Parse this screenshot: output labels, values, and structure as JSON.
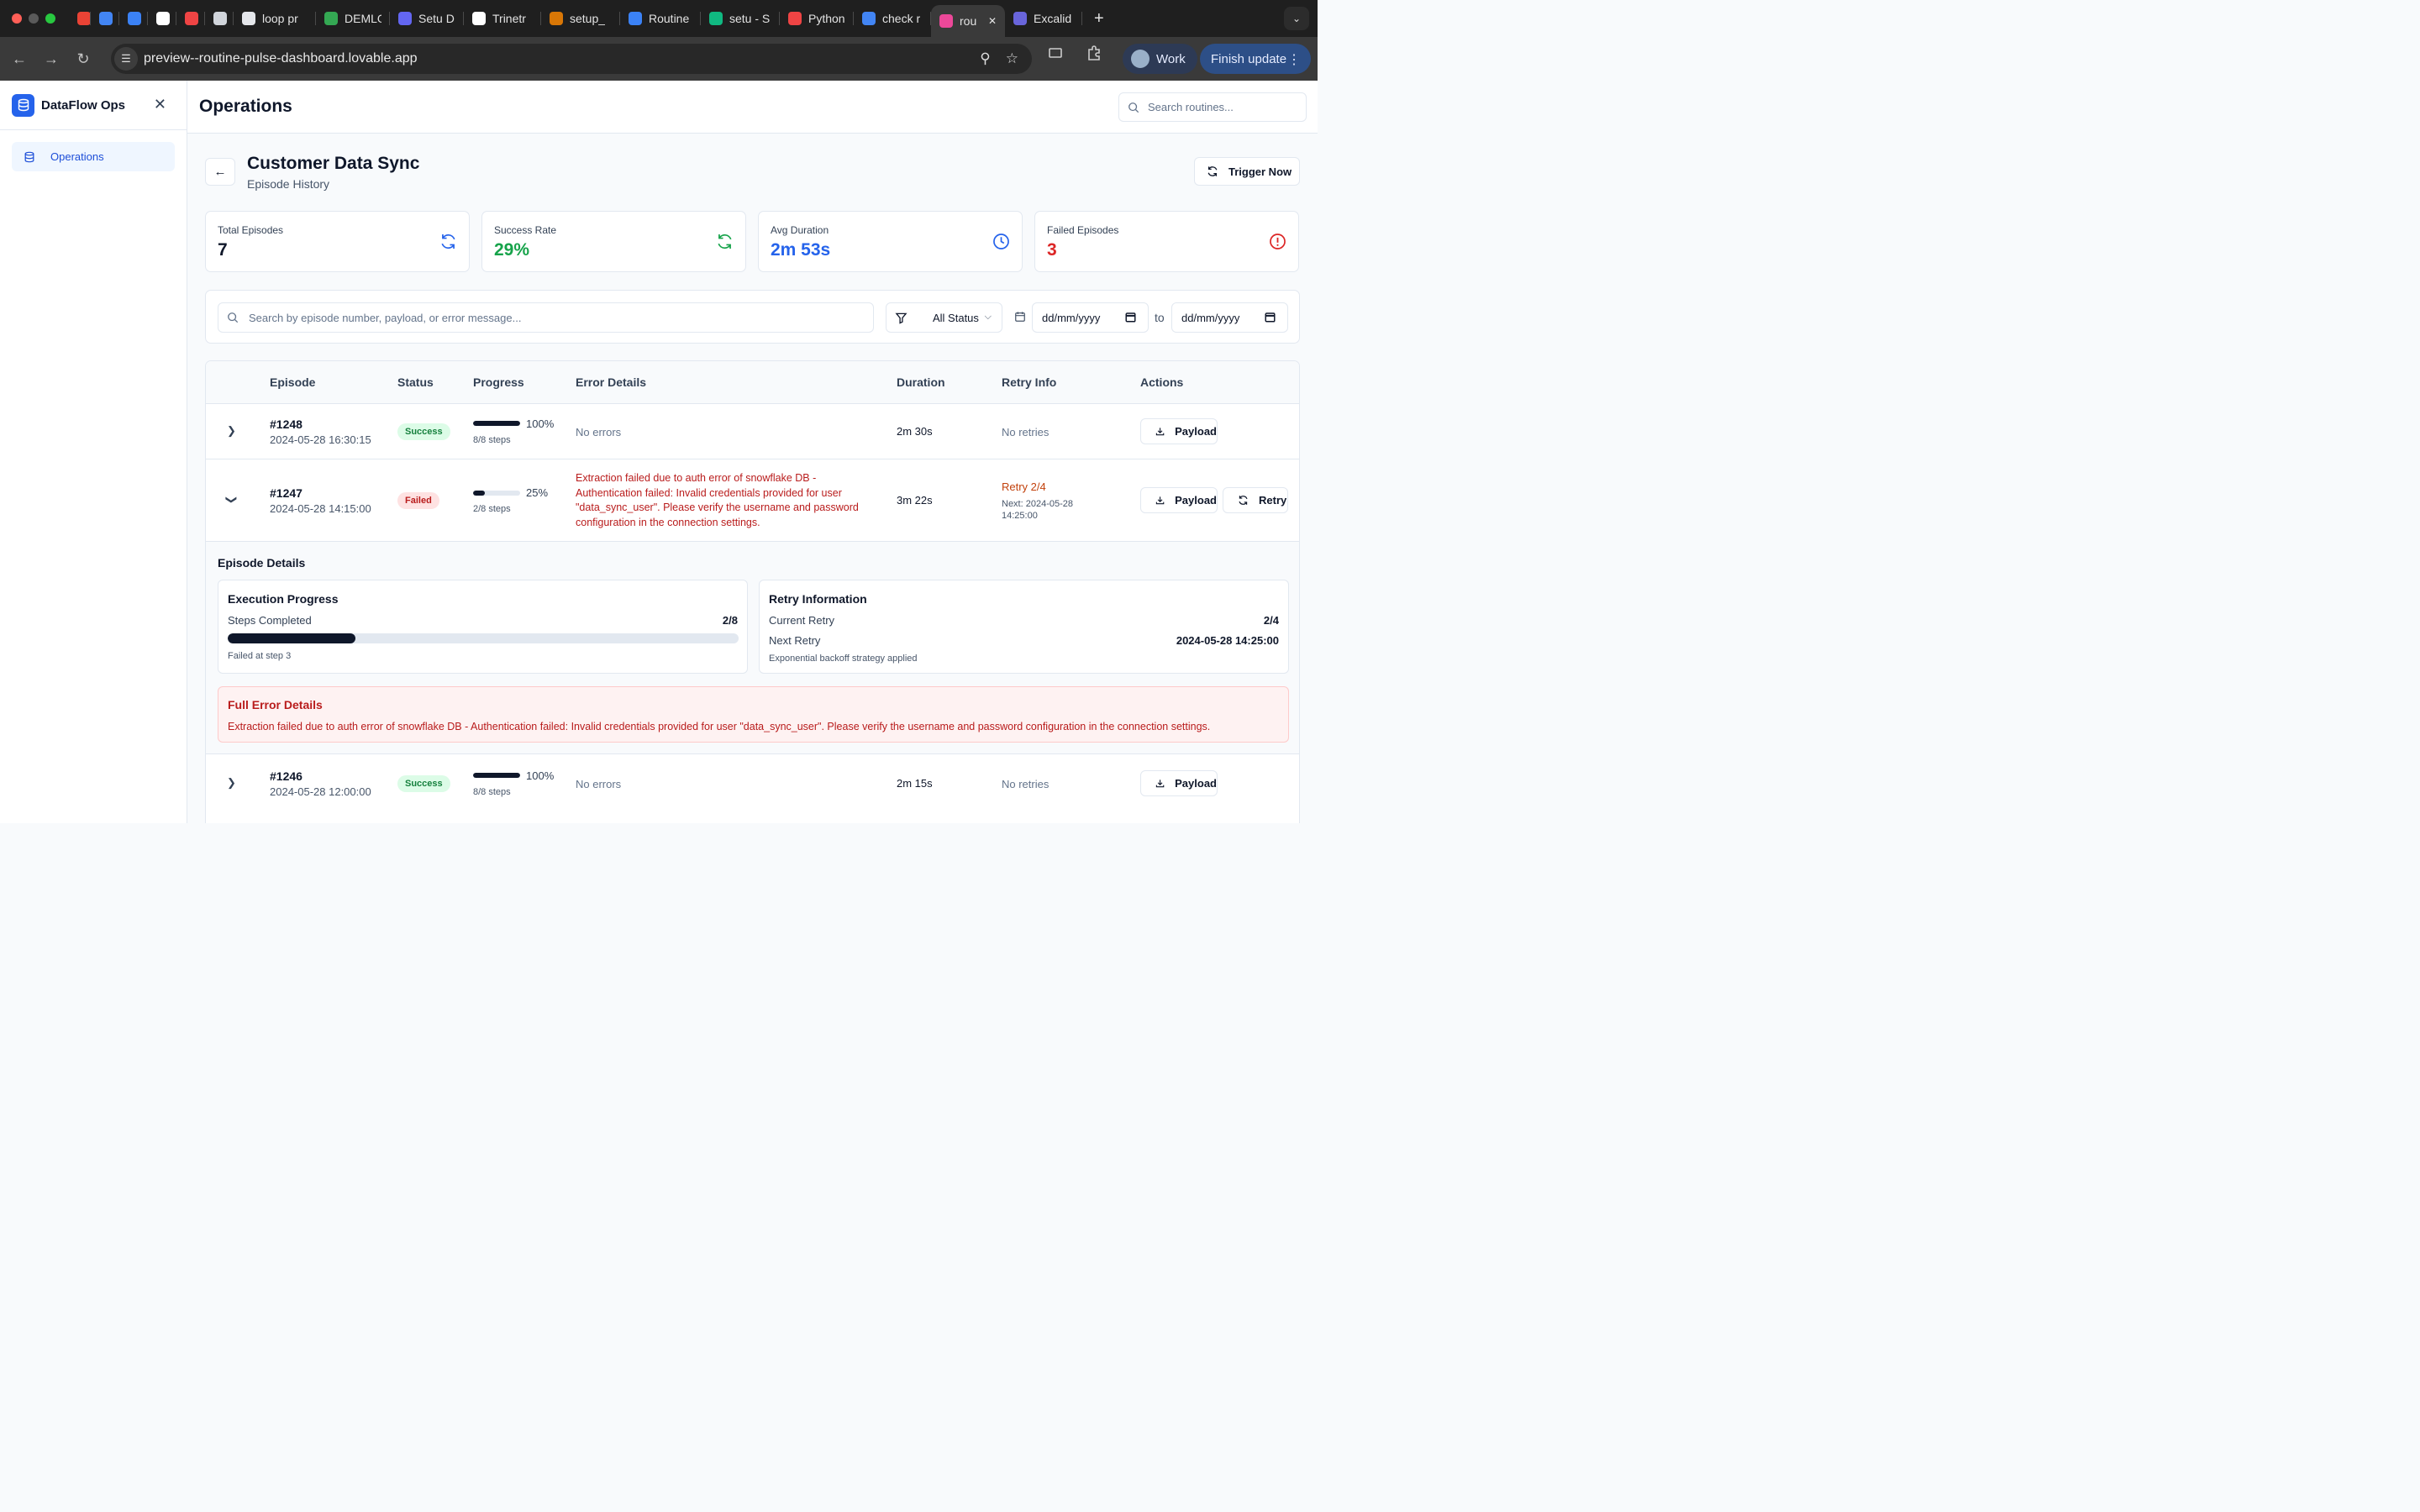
{
  "browser": {
    "tabs": [
      {
        "title": "",
        "icon": "gmail-icon",
        "color": "#ea4335"
      },
      {
        "title": "",
        "icon": "calendar-icon",
        "color": "#4285f4"
      },
      {
        "title": "",
        "icon": "k-icon",
        "color": "#3b82f6"
      },
      {
        "title": "",
        "icon": "github-icon",
        "color": "#ffffff"
      },
      {
        "title": "",
        "icon": "app-icon",
        "color": "#ef4444"
      },
      {
        "title": "",
        "icon": "openai-icon",
        "color": "#d1d5db"
      },
      {
        "title": "loop pr",
        "icon": "loop-icon",
        "color": "#e5e7eb"
      },
      {
        "title": "DEMLO",
        "icon": "drive-icon",
        "color": "#34a853"
      },
      {
        "title": "Setu D",
        "icon": "setu-icon",
        "color": "#6366f1"
      },
      {
        "title": "Trinetr",
        "icon": "trinetra-icon",
        "color": "#ffffff"
      },
      {
        "title": "setup_",
        "icon": "claude-icon",
        "color": "#d97706"
      },
      {
        "title": "Routine",
        "icon": "routine-icon",
        "color": "#3b82f6"
      },
      {
        "title": "setu - S",
        "icon": "setu-s-icon",
        "color": "#10b981"
      },
      {
        "title": "Python",
        "icon": "youtube-icon",
        "color": "#ef4444"
      },
      {
        "title": "check r",
        "icon": "google-icon",
        "color": "#4285f4"
      },
      {
        "title": "rou",
        "icon": "lovable-icon",
        "color": "#ec4899",
        "active": true
      },
      {
        "title": "Excalid",
        "icon": "excalidraw-icon",
        "color": "#6965db"
      }
    ],
    "url": "preview--routine-pulse-dashboard.lovable.app",
    "profile_label": "Work",
    "update_label": "Finish update"
  },
  "sidebar": {
    "brand": "DataFlow Ops",
    "items": [
      {
        "label": "Operations"
      }
    ]
  },
  "header": {
    "title": "Operations",
    "search_placeholder": "Search routines..."
  },
  "page": {
    "title": "Customer Data Sync",
    "subtitle": "Episode History",
    "trigger_label": "Trigger Now"
  },
  "stats": [
    {
      "label": "Total Episodes",
      "value": "7",
      "color": "#0f172a",
      "icon": "refresh-icon",
      "icon_color": "#2563eb"
    },
    {
      "label": "Success Rate",
      "value": "29%",
      "color": "#16a34a",
      "icon": "refresh-icon",
      "icon_color": "#16a34a"
    },
    {
      "label": "Avg Duration",
      "value": "2m 53s",
      "color": "#2563eb",
      "icon": "clock-icon",
      "icon_color": "#2563eb"
    },
    {
      "label": "Failed Episodes",
      "value": "3",
      "color": "#dc2626",
      "icon": "alert-icon",
      "icon_color": "#dc2626"
    }
  ],
  "filters": {
    "search_placeholder": "Search by episode number, payload, or error message...",
    "status_value": "All Status",
    "date_from": "dd/mm/yyyy",
    "date_to": "dd/mm/yyyy",
    "to_label": "to"
  },
  "table": {
    "columns": [
      "Episode",
      "Status",
      "Progress",
      "Error Details",
      "Duration",
      "Retry Info",
      "Actions"
    ],
    "rows": [
      {
        "episode": "#1248",
        "date": "2024-05-28 16:30:15",
        "status": "Success",
        "progress_pct": "100%",
        "progress": 1.0,
        "steps": "8/8 steps",
        "error": "No errors",
        "duration": "2m 30s",
        "retry": "No retries",
        "payload_label": "Payload"
      },
      {
        "episode": "#1247",
        "date": "2024-05-28 14:15:00",
        "status": "Failed",
        "progress_pct": "25%",
        "progress": 0.25,
        "steps": "2/8 steps",
        "error": "Extraction failed due to auth error of snowflake DB - Authentication failed: Invalid credentials provided for user \"data_sync_user\". Please verify the username and password configuration in the connection settings.",
        "duration": "3m 22s",
        "retry": "Retry 2/4",
        "retry_next": "Next: 2024-05-28 14:25:00",
        "payload_label": "Payload",
        "retry_label": "Retry"
      },
      {
        "episode": "#1246",
        "date": "2024-05-28 12:00:00",
        "status": "Success",
        "progress_pct": "100%",
        "progress": 1.0,
        "steps": "8/8 steps",
        "error": "No errors",
        "duration": "2m 15s",
        "retry": "No retries",
        "payload_label": "Payload"
      }
    ]
  },
  "details": {
    "title": "Episode Details",
    "execution": {
      "title": "Execution Progress",
      "steps_label": "Steps Completed",
      "steps_value": "2/8",
      "progress": 0.25,
      "note": "Failed at step 3"
    },
    "retry": {
      "title": "Retry Information",
      "current_label": "Current Retry",
      "current_value": "2/4",
      "next_label": "Next Retry",
      "next_value": "2024-05-28 14:25:00",
      "note": "Exponential backoff strategy applied"
    },
    "error": {
      "title": "Full Error Details",
      "text": "Extraction failed due to auth error of snowflake DB - Authentication failed: Invalid credentials provided for user \"data_sync_user\". Please verify the username and password configuration in the connection settings."
    }
  }
}
